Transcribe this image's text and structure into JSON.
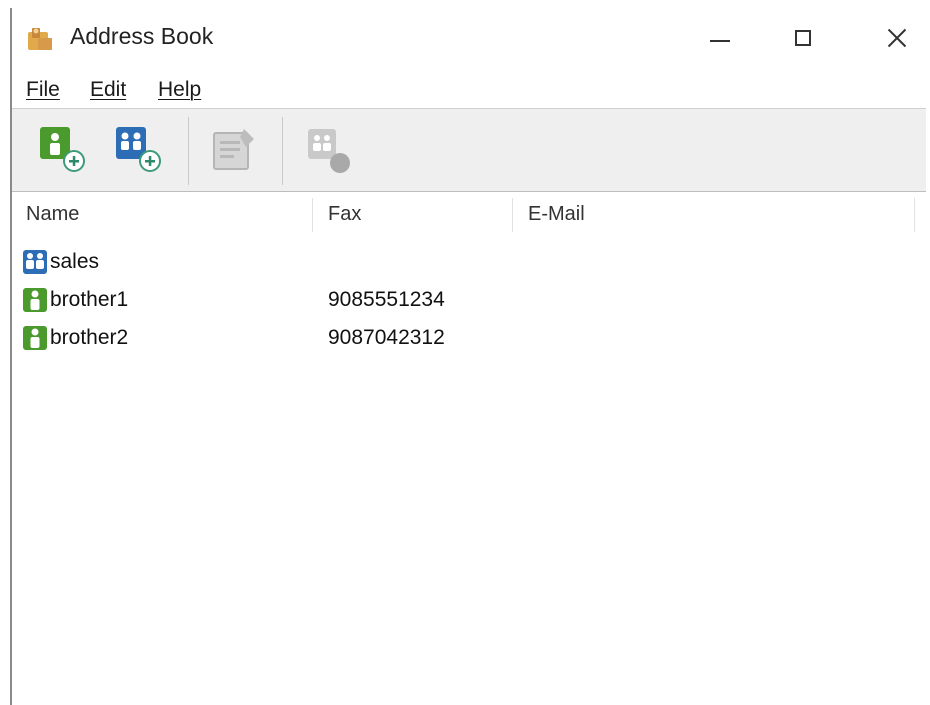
{
  "window": {
    "title": "Address Book",
    "icon": "address-book-icon"
  },
  "window_controls": [
    "minimize-icon",
    "maximize-icon",
    "close-icon"
  ],
  "menubar": {
    "items": [
      {
        "label": "File"
      },
      {
        "label": "Edit"
      },
      {
        "label": "Help"
      }
    ]
  },
  "toolbar": {
    "buttons": [
      {
        "icon": "add-contact-icon",
        "enabled": true
      },
      {
        "icon": "add-group-icon",
        "enabled": true
      },
      {
        "icon": "edit-icon",
        "enabled": false
      },
      {
        "icon": "delete-icon",
        "enabled": false
      }
    ]
  },
  "list": {
    "columns": [
      "Name",
      "Fax",
      "E-Mail"
    ],
    "rows": [
      {
        "type": "group",
        "icon": "group-icon",
        "name": "sales",
        "fax": "",
        "email": ""
      },
      {
        "type": "contact",
        "icon": "contact-icon",
        "name": "brother1",
        "fax": "9085551234",
        "email": ""
      },
      {
        "type": "contact",
        "icon": "contact-icon",
        "name": "brother2",
        "fax": "9087042312",
        "email": ""
      }
    ]
  },
  "colors": {
    "contact_green": "#4a9a2e",
    "group_blue": "#2d6db5",
    "toolbar_bg": "#efefef"
  }
}
